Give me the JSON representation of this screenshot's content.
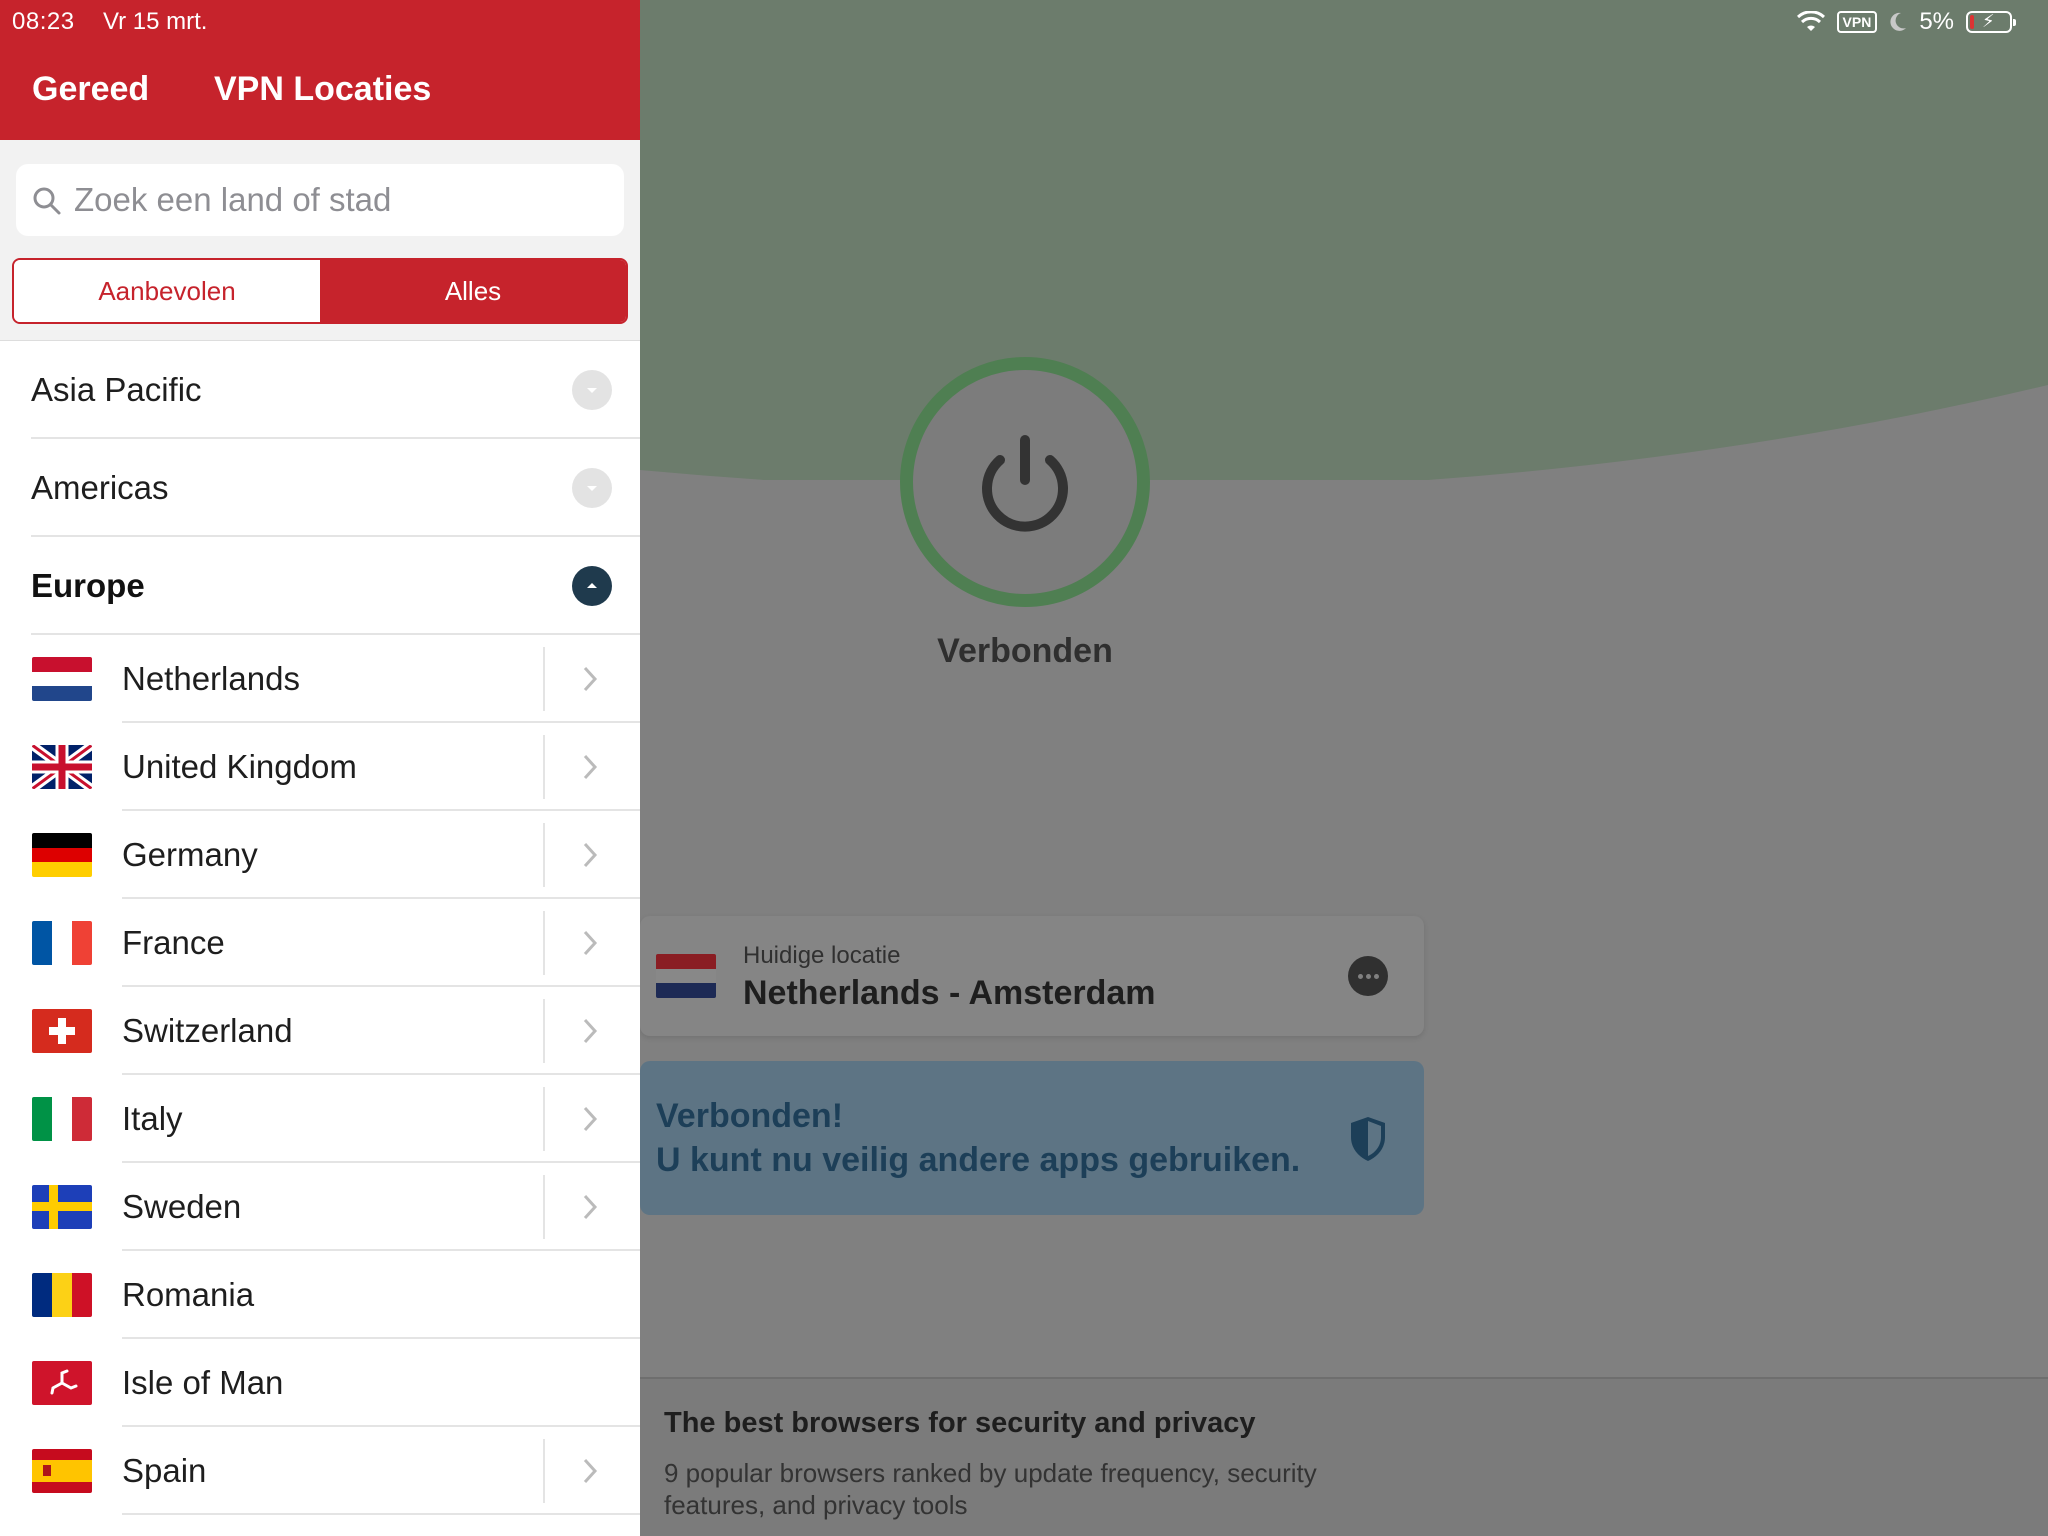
{
  "status_bar": {
    "time": "08:23",
    "date": "Vr 15 mrt.",
    "vpn_badge": "VPN",
    "battery": "5%"
  },
  "sheet": {
    "done_label": "Gereed",
    "title": "VPN Locaties",
    "search_placeholder": "Zoek een land of stad",
    "segments": {
      "recommended": "Aanbevolen",
      "all": "Alles",
      "selected": "all"
    },
    "regions": [
      {
        "label": "Asia Pacific",
        "expanded": false
      },
      {
        "label": "Americas",
        "expanded": false
      },
      {
        "label": "Europe",
        "expanded": true
      }
    ],
    "countries": [
      {
        "label": "Netherlands",
        "flag": "nl",
        "has_cities": true
      },
      {
        "label": "United Kingdom",
        "flag": "gb",
        "has_cities": true
      },
      {
        "label": "Germany",
        "flag": "de",
        "has_cities": true
      },
      {
        "label": "France",
        "flag": "fr",
        "has_cities": true
      },
      {
        "label": "Switzerland",
        "flag": "ch",
        "has_cities": true
      },
      {
        "label": "Italy",
        "flag": "it",
        "has_cities": true
      },
      {
        "label": "Sweden",
        "flag": "se",
        "has_cities": true
      },
      {
        "label": "Romania",
        "flag": "ro",
        "has_cities": false
      },
      {
        "label": "Isle of Man",
        "flag": "im",
        "has_cities": false
      },
      {
        "label": "Spain",
        "flag": "es",
        "has_cities": true
      }
    ]
  },
  "main": {
    "connection_status": "Verbonden",
    "current_location": {
      "label": "Huidige locatie",
      "value": "Netherlands - Amsterdam",
      "flag": "nl"
    },
    "banner": {
      "title": "Verbonden!",
      "text": "U kunt nu veilig andere apps gebruiken."
    },
    "article": {
      "title": "The best browsers for security and privacy",
      "description": "9 popular browsers ranked by update frequency, security features, and privacy tools"
    }
  },
  "colors": {
    "brand_red": "#c6232c",
    "connected_green": "#4f7f52",
    "overlay_gray": "#808080",
    "banner_blue": "#5d7484",
    "region_expanded": "#1f3a4d"
  }
}
